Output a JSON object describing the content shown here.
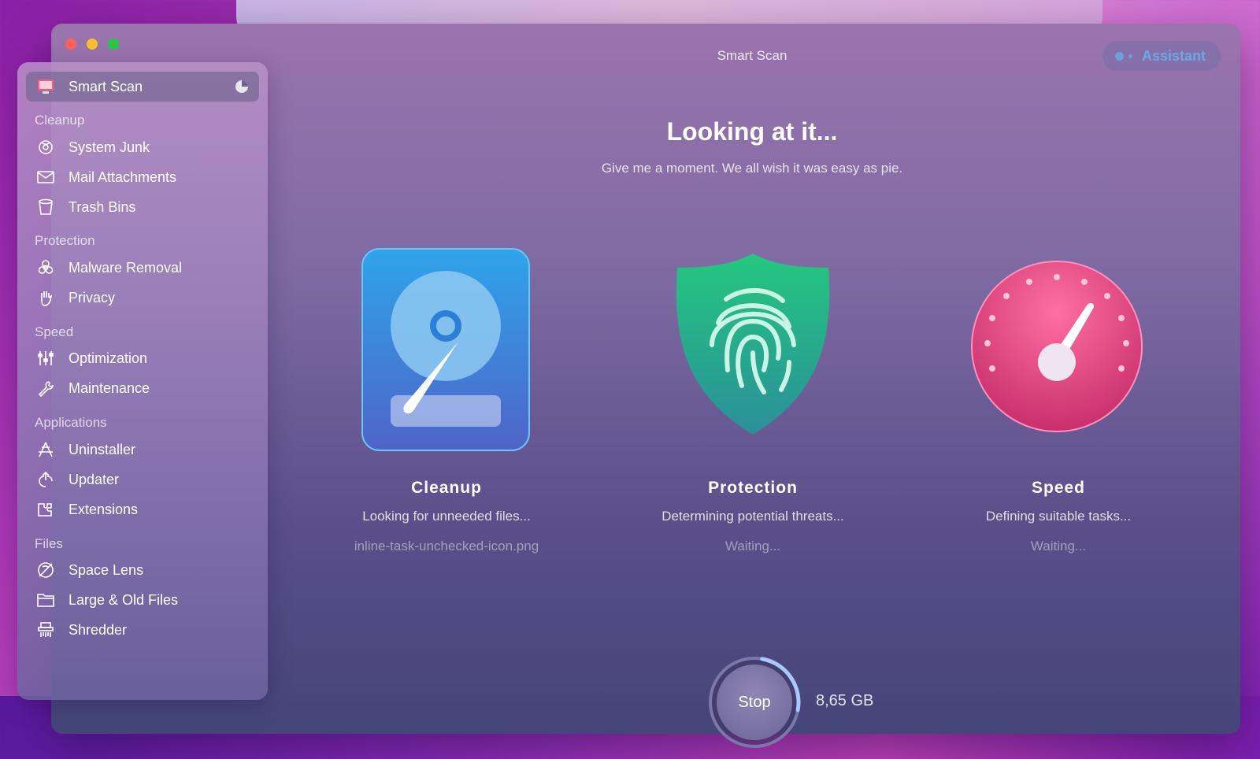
{
  "window": {
    "title": "Smart Scan",
    "assistant_label": "Assistant"
  },
  "sidebar": {
    "active": {
      "label": "Smart Scan",
      "icon": "smart-scan-icon"
    },
    "sections": [
      {
        "title": "Cleanup",
        "items": [
          {
            "label": "System Junk",
            "icon": "system-junk-icon"
          },
          {
            "label": "Mail Attachments",
            "icon": "mail-icon"
          },
          {
            "label": "Trash Bins",
            "icon": "trash-icon"
          }
        ]
      },
      {
        "title": "Protection",
        "items": [
          {
            "label": "Malware Removal",
            "icon": "biohazard-icon"
          },
          {
            "label": "Privacy",
            "icon": "hand-icon"
          }
        ]
      },
      {
        "title": "Speed",
        "items": [
          {
            "label": "Optimization",
            "icon": "sliders-icon"
          },
          {
            "label": "Maintenance",
            "icon": "wrench-icon"
          }
        ]
      },
      {
        "title": "Applications",
        "items": [
          {
            "label": "Uninstaller",
            "icon": "uninstaller-icon"
          },
          {
            "label": "Updater",
            "icon": "updater-icon"
          },
          {
            "label": "Extensions",
            "icon": "extensions-icon"
          }
        ]
      },
      {
        "title": "Files",
        "items": [
          {
            "label": "Space Lens",
            "icon": "space-lens-icon"
          },
          {
            "label": "Large & Old Files",
            "icon": "folder-icon"
          },
          {
            "label": "Shredder",
            "icon": "shredder-icon"
          }
        ]
      }
    ]
  },
  "main": {
    "headline": "Looking at it...",
    "subline": "Give me a moment. We all wish it was easy as pie.",
    "modules": [
      {
        "name": "Cleanup",
        "status": "Looking for unneeded files...",
        "sub": "inline-task-unchecked-icon.png",
        "icon": "hard-drive-icon"
      },
      {
        "name": "Protection",
        "status": "Determining potential threats...",
        "sub": "Waiting...",
        "icon": "fingerprint-shield-icon"
      },
      {
        "name": "Speed",
        "status": "Defining suitable tasks...",
        "sub": "Waiting...",
        "icon": "speedometer-icon"
      }
    ],
    "stop_label": "Stop",
    "scanned_size": "8,65 GB",
    "scan_progress": 0.25
  },
  "colors": {
    "accent_blue": "#6aa9e6",
    "cleanup_blue": "#3d8fe0",
    "protection_green": "#1fb383",
    "speed_pink": "#e0417f"
  }
}
